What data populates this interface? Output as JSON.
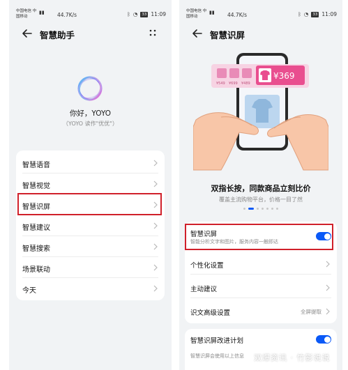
{
  "left": {
    "status": {
      "carrier": "中国电信 中国移动",
      "speed": "44.7K/s",
      "battery": "33",
      "time": "11:09"
    },
    "header": {
      "title": "智慧助手"
    },
    "greeting": {
      "hello": "你好，YOYO",
      "sub": "（YOYO 读作\"优优\"）"
    },
    "menu": [
      {
        "label": "智慧语音"
      },
      {
        "label": "智慧视觉"
      },
      {
        "label": "智慧识屏"
      },
      {
        "label": "智慧建议"
      },
      {
        "label": "智慧搜索"
      },
      {
        "label": "场景联动"
      },
      {
        "label": "今天"
      }
    ]
  },
  "right": {
    "status": {
      "carrier": "中国电信 中国移动",
      "speed": "44.7K/s",
      "battery": "33",
      "time": "11:09"
    },
    "header": {
      "title": "智慧识屏"
    },
    "illustration": {
      "price_big": "¥369",
      "prices_small": [
        "¥549",
        "¥699",
        "¥489"
      ]
    },
    "headline": "双指长按，同款商品立刻比价",
    "subline": "覆盖主流购物平台，价格一目了然",
    "settings": {
      "toggle_row": {
        "label": "智慧识屏",
        "desc": "智能分析文字和图片，服务内容一触即达",
        "on": true
      },
      "personalize": {
        "label": "个性化设置"
      },
      "suggest": {
        "label": "主动建议"
      },
      "ocr": {
        "label": "识文高级设置",
        "value": "全屏提取"
      }
    },
    "plan": {
      "label": "智慧识屏改进计划",
      "on": true,
      "desc": "智慧识屏会使用以上信息"
    }
  },
  "watermark": "双爆资讯 · 竹影说说",
  "colors": {
    "accent": "#0a59f7",
    "highlight": "#d0202a",
    "bg": "#f1f3f5"
  }
}
